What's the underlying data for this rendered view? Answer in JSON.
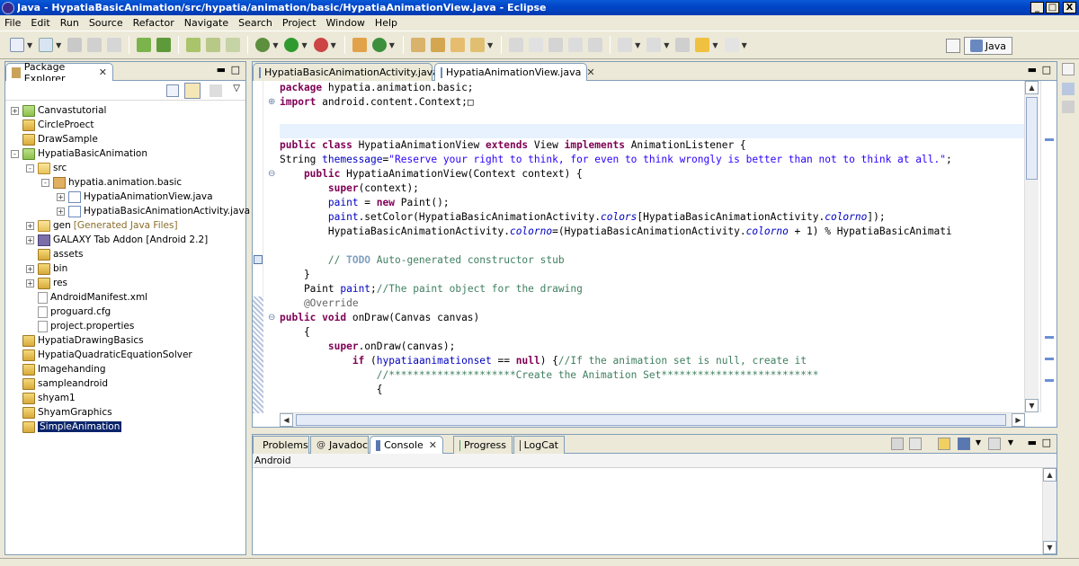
{
  "window": {
    "title": "Java - HypatiaBasicAnimation/src/hypatia/animation/basic/HypatiaAnimationView.java - Eclipse",
    "minimize": "_",
    "maximize": "□",
    "close": "X"
  },
  "menu": [
    "File",
    "Edit",
    "Run",
    "Source",
    "Refactor",
    "Navigate",
    "Search",
    "Project",
    "Window",
    "Help"
  ],
  "perspective": {
    "label": "Java"
  },
  "package_explorer": {
    "title": "Package Explorer",
    "items": [
      {
        "label": "Canvastutorial",
        "indent": 0,
        "expander": "+",
        "icon": "android-project-icon"
      },
      {
        "label": "CircleProect",
        "indent": 0,
        "expander": "",
        "icon": "folder-icon"
      },
      {
        "label": "DrawSample",
        "indent": 0,
        "expander": "",
        "icon": "folder-icon"
      },
      {
        "label": "HypatiaBasicAnimation",
        "indent": 0,
        "expander": "-",
        "icon": "android-project-icon"
      },
      {
        "label": "src",
        "indent": 1,
        "expander": "-",
        "icon": "source-folder-icon"
      },
      {
        "label": "hypatia.animation.basic",
        "indent": 2,
        "expander": "-",
        "icon": "package-icon"
      },
      {
        "label": "HypatiaAnimationView.java",
        "indent": 3,
        "expander": "+",
        "icon": "java-file-icon"
      },
      {
        "label": "HypatiaBasicAnimationActivity.java",
        "indent": 3,
        "expander": "+",
        "icon": "java-file-icon"
      },
      {
        "label": "gen",
        "decor": "[Generated Java Files]",
        "indent": 1,
        "expander": "+",
        "icon": "source-folder-icon"
      },
      {
        "label": "GALAXY Tab Addon [Android 2.2]",
        "indent": 1,
        "expander": "+",
        "icon": "library-icon"
      },
      {
        "label": "assets",
        "indent": 1,
        "expander": "",
        "icon": "folder-icon"
      },
      {
        "label": "bin",
        "indent": 1,
        "expander": "+",
        "icon": "folder-icon"
      },
      {
        "label": "res",
        "indent": 1,
        "expander": "+",
        "icon": "folder-icon"
      },
      {
        "label": "AndroidManifest.xml",
        "indent": 1,
        "expander": "",
        "icon": "xml-file-icon"
      },
      {
        "label": "proguard.cfg",
        "indent": 1,
        "expander": "",
        "icon": "file-icon"
      },
      {
        "label": "project.properties",
        "indent": 1,
        "expander": "",
        "icon": "file-icon"
      },
      {
        "label": "HypatiaDrawingBasics",
        "indent": 0,
        "expander": "",
        "icon": "folder-icon"
      },
      {
        "label": "HypatiaQuadraticEquationSolver",
        "indent": 0,
        "expander": "",
        "icon": "folder-icon"
      },
      {
        "label": "Imagehanding",
        "indent": 0,
        "expander": "",
        "icon": "folder-icon"
      },
      {
        "label": "sampleandroid",
        "indent": 0,
        "expander": "",
        "icon": "folder-icon"
      },
      {
        "label": "shyam1",
        "indent": 0,
        "expander": "",
        "icon": "folder-icon"
      },
      {
        "label": "ShyamGraphics",
        "indent": 0,
        "expander": "",
        "icon": "folder-icon"
      },
      {
        "label": "SimpleAnimation",
        "indent": 0,
        "expander": "",
        "icon": "folder-icon",
        "selected": true
      }
    ]
  },
  "editor": {
    "tabs": [
      {
        "label": "HypatiaBasicAnimationActivity.java",
        "active": false
      },
      {
        "label": "HypatiaAnimationView.java",
        "active": true
      }
    ],
    "code": [
      [
        {
          "t": "package ",
          "c": "kw"
        },
        {
          "t": "hypatia.animation.basic;",
          "c": ""
        }
      ],
      [
        {
          "t": "import ",
          "c": "kw"
        },
        {
          "t": "android.content.Context;",
          "c": ""
        },
        {
          "t": "□",
          "c": ""
        }
      ],
      [],
      [],
      [
        {
          "t": "public class ",
          "c": "kw"
        },
        {
          "t": "HypatiaAnimationView ",
          "c": ""
        },
        {
          "t": "extends ",
          "c": "kw"
        },
        {
          "t": "View ",
          "c": ""
        },
        {
          "t": "implements ",
          "c": "kw"
        },
        {
          "t": "AnimationListener {",
          "c": ""
        }
      ],
      [
        {
          "t": "String ",
          "c": ""
        },
        {
          "t": "themessage",
          "c": "fld"
        },
        {
          "t": "=",
          "c": ""
        },
        {
          "t": "\"Reserve your right to think, for even to think wrongly is better than not to think at all.\"",
          "c": "str"
        },
        {
          "t": ";",
          "c": ""
        }
      ],
      [
        {
          "t": "    public ",
          "c": "kw"
        },
        {
          "t": "HypatiaAnimationView(Context context) {",
          "c": ""
        }
      ],
      [
        {
          "t": "        super",
          "c": "kw"
        },
        {
          "t": "(context);",
          "c": ""
        }
      ],
      [
        {
          "t": "        paint",
          "c": "fld"
        },
        {
          "t": " = ",
          "c": ""
        },
        {
          "t": "new ",
          "c": "kw"
        },
        {
          "t": "Paint();",
          "c": ""
        }
      ],
      [
        {
          "t": "        paint",
          "c": "fld"
        },
        {
          "t": ".setColor(HypatiaBasicAnimationActivity.",
          "c": ""
        },
        {
          "t": "colors",
          "c": "it"
        },
        {
          "t": "[HypatiaBasicAnimationActivity.",
          "c": ""
        },
        {
          "t": "colorno",
          "c": "it"
        },
        {
          "t": "]);",
          "c": ""
        }
      ],
      [
        {
          "t": "        HypatiaBasicAnimationActivity.",
          "c": ""
        },
        {
          "t": "colorno",
          "c": "it"
        },
        {
          "t": "=(HypatiaBasicAnimationActivity.",
          "c": ""
        },
        {
          "t": "colorno",
          "c": "it"
        },
        {
          "t": " + 1) % HypatiaBasicAnimati",
          "c": ""
        }
      ],
      [],
      [
        {
          "t": "        // ",
          "c": "cm"
        },
        {
          "t": "TODO",
          "c": "todo"
        },
        {
          "t": " Auto-generated constructor stub",
          "c": "cm"
        }
      ],
      [
        {
          "t": "    }",
          "c": ""
        }
      ],
      [
        {
          "t": "    Paint ",
          "c": ""
        },
        {
          "t": "paint",
          "c": "fld"
        },
        {
          "t": ";",
          "c": ""
        },
        {
          "t": "//The paint object for the drawing",
          "c": "cm"
        }
      ],
      [
        {
          "t": "    @Override",
          "c": "ann"
        }
      ],
      [
        {
          "t": "public void ",
          "c": "kw"
        },
        {
          "t": "onDraw(Canvas canvas)",
          "c": ""
        }
      ],
      [
        {
          "t": "    {",
          "c": ""
        }
      ],
      [
        {
          "t": "        super",
          "c": "kw"
        },
        {
          "t": ".onDraw(canvas);",
          "c": ""
        }
      ],
      [
        {
          "t": "            if ",
          "c": "kw"
        },
        {
          "t": "(",
          "c": ""
        },
        {
          "t": "hypatiaanimationset",
          "c": "fld"
        },
        {
          "t": " == ",
          "c": ""
        },
        {
          "t": "null",
          "c": "kw"
        },
        {
          "t": ") {",
          "c": ""
        },
        {
          "t": "//If the animation set is null, create it",
          "c": "cm"
        }
      ],
      [
        {
          "t": "                //*********************Create the Animation Set**************************",
          "c": "cm"
        }
      ],
      [
        {
          "t": "                {",
          "c": ""
        }
      ]
    ]
  },
  "bottom_panel": {
    "tabs": [
      {
        "label": "Problems",
        "active": false
      },
      {
        "label": "Javadoc",
        "active": false
      },
      {
        "label": "Console",
        "active": true
      },
      {
        "label": "Progress",
        "active": false
      },
      {
        "label": "LogCat",
        "active": false
      }
    ],
    "console_name": "Android"
  }
}
